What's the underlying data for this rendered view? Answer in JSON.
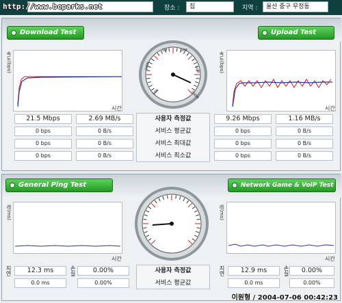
{
  "top": {
    "watermark": "http://www.bcparks.net",
    "location_label": "장소 :",
    "location_value": "집",
    "region_label": "지역 :",
    "region_value": "울산 중구 우정동"
  },
  "speed": {
    "download_label": "Download Test",
    "upload_label": "Upload Test",
    "y_label": "속도(bps)",
    "x_label": "시간",
    "row_labels": [
      "사용자 측정값",
      "서비스 평균값",
      "서비스 최대값",
      "서비스 최소값"
    ],
    "download_values": [
      [
        "21.5 Mbps",
        "2.69 MB/s"
      ],
      [
        "0 bps",
        "0 B/s"
      ],
      [
        "0 bps",
        "0 B/s"
      ],
      [
        "0 bps",
        "0 B/s"
      ]
    ],
    "upload_values": [
      [
        "9.26 Mbps",
        "1.16 MB/s"
      ],
      [
        "0 bps",
        "0 B/s"
      ],
      [
        "0 bps",
        "0 B/s"
      ],
      [
        "0 bps",
        "0 B/s"
      ]
    ],
    "gauge_ticks": [
      "10K",
      "100K",
      "1M",
      "10M",
      "50M",
      "100M"
    ]
  },
  "ping": {
    "ping_label": "General Ping Test",
    "game_label": "Network Game & VoIP Test",
    "y_label": "레(ms)",
    "x_label": "시간",
    "delay_label": "지연",
    "loss_label": "손실",
    "row_labels": [
      "사용자 측정값",
      "서비스 평균값"
    ],
    "ping_values": [
      [
        "12.3 ms",
        "0.00%"
      ],
      [
        "0.0 ms",
        "0.00%"
      ]
    ],
    "game_values": [
      [
        "12.9 ms",
        "0.00%"
      ],
      [
        "0.0 ms",
        "0.00%"
      ]
    ]
  },
  "footer": "이원형 / 2004-07-06 00:42:23",
  "colors": {
    "accent_green": "#2fb52f",
    "dark_bar": "#0f3f3f",
    "series_blue": "#2233aa",
    "series_red": "#d01818"
  }
}
